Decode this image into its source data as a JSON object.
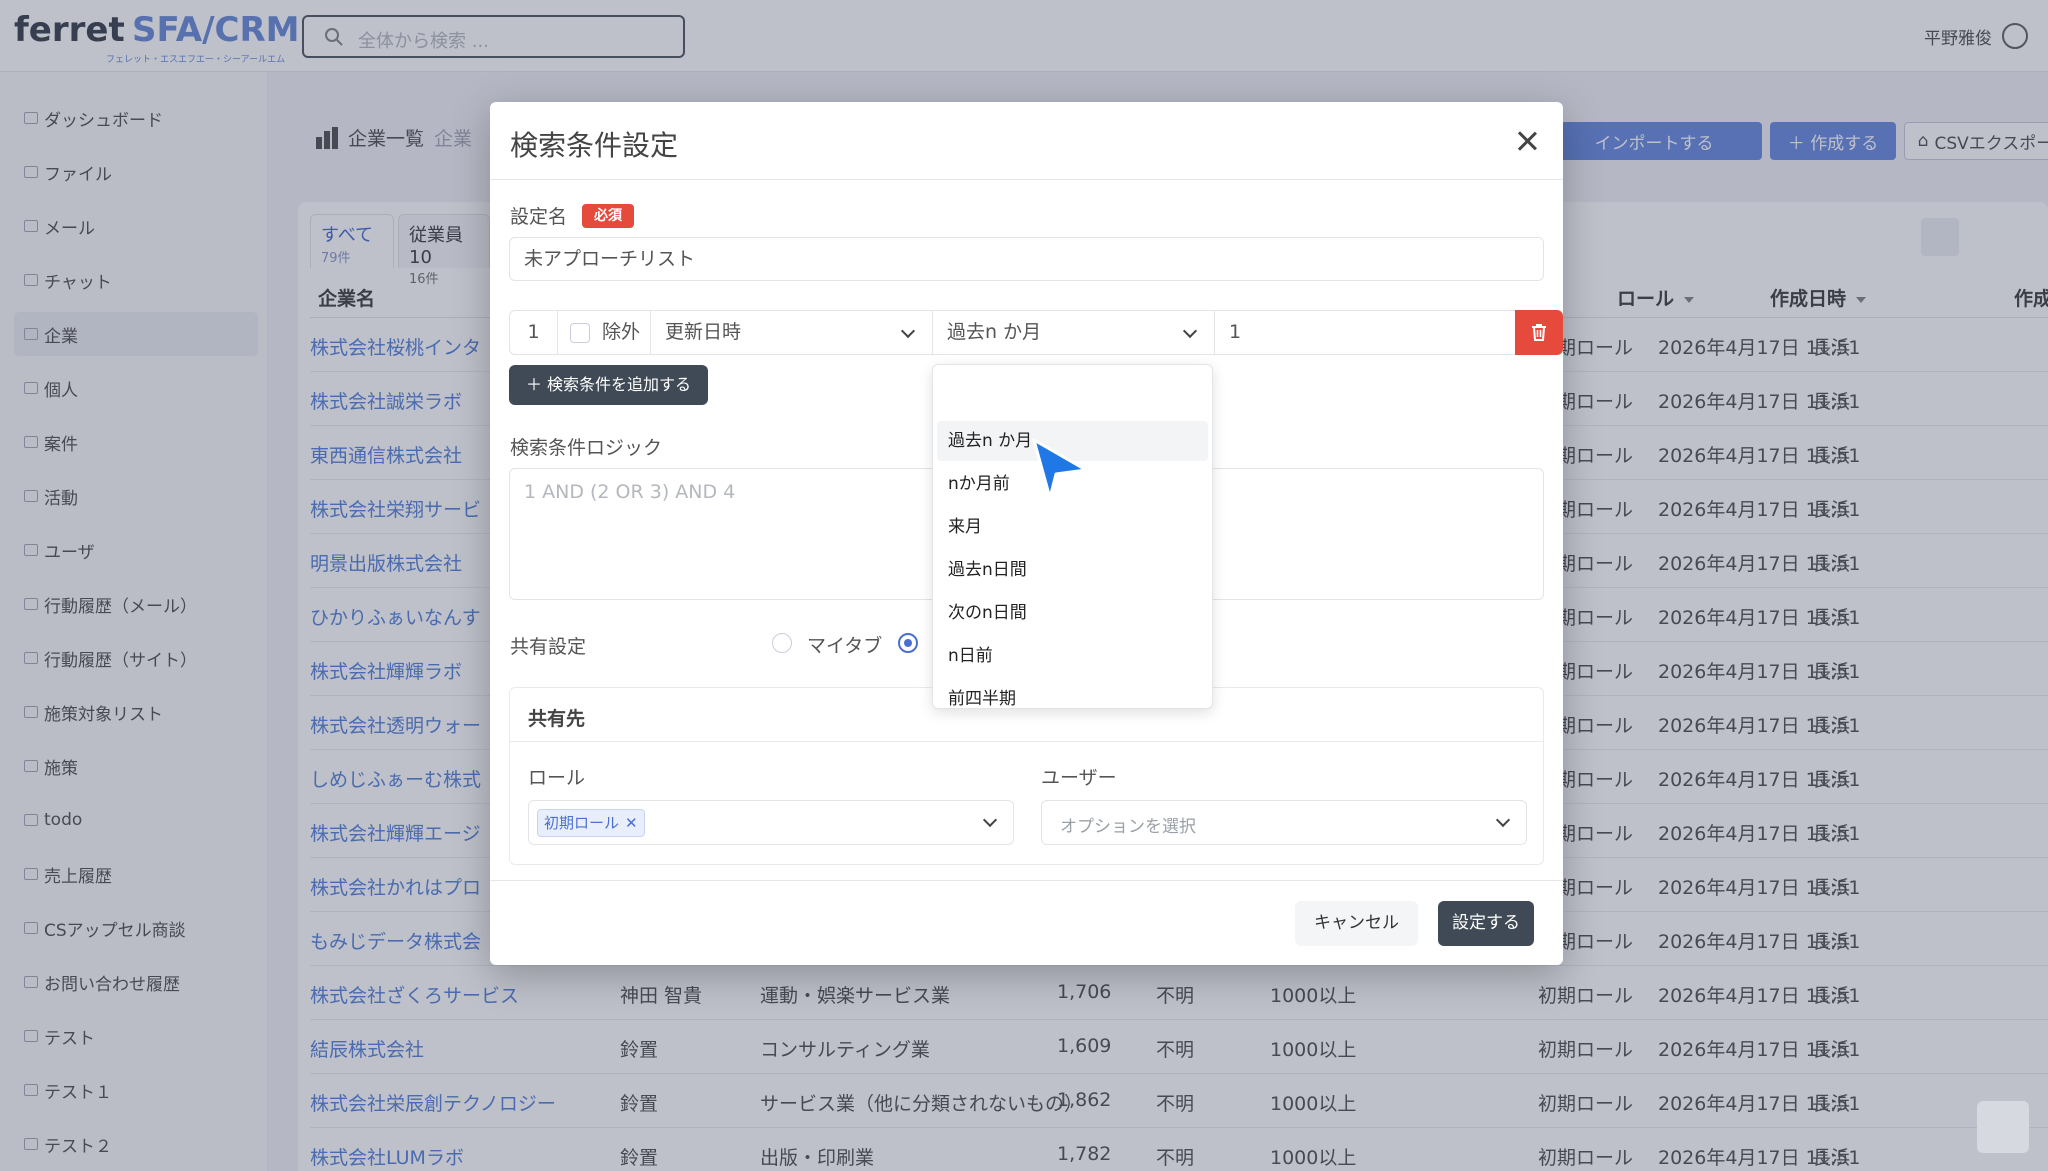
{
  "app": {
    "logo_main": "ferret",
    "logo_product": "SFA/CRM",
    "logo_sub": "フェレット・エスエフエー・シーアールエム",
    "search_placeholder": "全体から検索 ...",
    "user_name": "平野雅俊"
  },
  "sidebar": {
    "items": [
      {
        "label": "ダッシュボード"
      },
      {
        "label": "ファイル"
      },
      {
        "label": "メール"
      },
      {
        "label": "チャット"
      },
      {
        "label": "企業"
      },
      {
        "label": "個人"
      },
      {
        "label": "案件"
      },
      {
        "label": "活動"
      },
      {
        "label": "ユーザ"
      },
      {
        "label": "行動履歴（メール）"
      },
      {
        "label": "行動履歴（サイト）"
      },
      {
        "label": "施策対象リスト"
      },
      {
        "label": "施策"
      },
      {
        "label": "todo"
      },
      {
        "label": "売上履歴"
      },
      {
        "label": "CSアップセル商談"
      },
      {
        "label": "お問い合わせ履歴"
      },
      {
        "label": "テスト"
      },
      {
        "label": "テスト１"
      },
      {
        "label": "テスト２"
      }
    ],
    "active_index": 4
  },
  "page": {
    "breadcrumb": "企業一覧",
    "breadcrumb2": "企業",
    "import_label": "インポートする",
    "create_label": "＋ 作成する",
    "csv_label": "CSVエクスポート",
    "tabs": [
      {
        "label": "すべて",
        "count": "79件"
      },
      {
        "label": "従業員10",
        "count": "16件"
      }
    ]
  },
  "table": {
    "headers": {
      "name": "企業名",
      "role": "ロール",
      "created": "作成日時",
      "creator": "作成"
    },
    "rows": [
      {
        "name": "株式会社桜桃インタ",
        "owner": "",
        "industry": "",
        "employees": "",
        "capital": "",
        "size": "",
        "role": "初期ロール",
        "created": "2026年4月17日 11:51",
        "creator": "長浜"
      },
      {
        "name": "株式会社誠栄ラボ",
        "owner": "",
        "industry": "",
        "employees": "",
        "capital": "",
        "size": "",
        "role": "初期ロール",
        "created": "2026年4月17日 11:51",
        "creator": "長浜"
      },
      {
        "name": "東西通信株式会社",
        "owner": "",
        "industry": "",
        "employees": "",
        "capital": "",
        "size": "",
        "role": "初期ロール",
        "created": "2026年4月17日 11:51",
        "creator": "長浜"
      },
      {
        "name": "株式会社栄翔サービ",
        "owner": "",
        "industry": "",
        "employees": "",
        "capital": "",
        "size": "",
        "role": "初期ロール",
        "created": "2026年4月17日 11:51",
        "creator": "長浜"
      },
      {
        "name": "明景出版株式会社",
        "owner": "",
        "industry": "",
        "employees": "",
        "capital": "",
        "size": "",
        "role": "初期ロール",
        "created": "2026年4月17日 11:51",
        "creator": "長浜"
      },
      {
        "name": "ひかりふぁいなんす",
        "owner": "",
        "industry": "",
        "employees": "",
        "capital": "",
        "size": "",
        "role": "初期ロール",
        "created": "2026年4月17日 11:51",
        "creator": "長浜"
      },
      {
        "name": "株式会社輝輝ラボ",
        "owner": "",
        "industry": "",
        "employees": "",
        "capital": "",
        "size": "",
        "role": "初期ロール",
        "created": "2026年4月17日 11:51",
        "creator": "長浜"
      },
      {
        "name": "株式会社透明ウォー",
        "owner": "",
        "industry": "",
        "employees": "",
        "capital": "",
        "size": "",
        "role": "初期ロール",
        "created": "2026年4月17日 11:51",
        "creator": "長浜"
      },
      {
        "name": "しめじふぁーむ株式",
        "owner": "",
        "industry": "",
        "employees": "",
        "capital": "",
        "size": "",
        "role": "初期ロール",
        "created": "2026年4月17日 11:51",
        "creator": "長浜"
      },
      {
        "name": "株式会社輝輝エージ",
        "owner": "",
        "industry": "",
        "employees": "",
        "capital": "",
        "size": "",
        "role": "初期ロール",
        "created": "2026年4月17日 11:51",
        "creator": "長浜"
      },
      {
        "name": "株式会社かれはプロ",
        "owner": "",
        "industry": "",
        "employees": "",
        "capital": "",
        "size": "",
        "role": "初期ロール",
        "created": "2026年4月17日 11:51",
        "creator": "長浜"
      },
      {
        "name": "もみじデータ株式会",
        "owner": "",
        "industry": "",
        "employees": "",
        "capital": "",
        "size": "",
        "role": "初期ロール",
        "created": "2026年4月17日 11:51",
        "creator": "長浜"
      },
      {
        "name": "株式会社ざくろサービス",
        "owner": "神田 智貴",
        "industry": "運動・娯楽サービス業",
        "employees": "1,706",
        "capital": "不明",
        "size": "1000以上",
        "role": "初期ロール",
        "created": "2026年4月17日 11:51",
        "creator": "長浜"
      },
      {
        "name": "結辰株式会社",
        "owner": "鈴置",
        "industry": "コンサルティング業",
        "employees": "1,609",
        "capital": "不明",
        "size": "1000以上",
        "role": "初期ロール",
        "created": "2026年4月17日 11:51",
        "creator": "長浜"
      },
      {
        "name": "株式会社栄辰創テクノロジー",
        "owner": "鈴置",
        "industry": "サービス業（他に分類されないもの）",
        "employees": "1,862",
        "capital": "不明",
        "size": "1000以上",
        "role": "初期ロール",
        "created": "2026年4月17日 11:51",
        "creator": "長浜"
      },
      {
        "name": "株式会社LUMラボ",
        "owner": "鈴置",
        "industry": "出版・印刷業",
        "employees": "1,782",
        "capital": "不明",
        "size": "1000以上",
        "role": "初期ロール",
        "created": "2026年4月17日 11:51",
        "creator": "長浜"
      }
    ]
  },
  "modal": {
    "title": "検索条件設定",
    "setting_name_label": "設定名",
    "required_badge": "必須",
    "setting_name_value": "未アプローチリスト",
    "condition": {
      "number": "1",
      "exclude_label": "除外",
      "exclude_checked": false,
      "field": "更新日時",
      "operator": "過去n か月",
      "value": "1"
    },
    "add_condition_label": "＋ 検索条件を追加する",
    "logic_label": "検索条件ロジック",
    "logic_placeholder": "1 AND (2 OR 3) AND 4",
    "share_label": "共有設定",
    "share_options": [
      {
        "label": "マイタブ",
        "selected": false
      },
      {
        "label": "",
        "selected": true
      }
    ],
    "share_target_title": "共有先",
    "role_label": "ロール",
    "role_chip": "初期ロール",
    "user_label": "ユーザー",
    "user_placeholder": "オプションを選択",
    "cancel_label": "キャンセル",
    "submit_label": "設定する"
  },
  "dropdown": {
    "items": [
      {
        "label": "過去n か月",
        "hover": true
      },
      {
        "label": "nか月前"
      },
      {
        "label": "来月"
      },
      {
        "label": "過去n日間"
      },
      {
        "label": "次のn日間"
      },
      {
        "label": "n日前"
      },
      {
        "label": "前四半期"
      }
    ]
  },
  "colors": {
    "accent": "#4b6fd0",
    "danger": "#e54a3d",
    "dark_button": "#3f4a56"
  },
  "icons": [
    "search-icon",
    "user-avatar-icon",
    "close-icon",
    "trash-icon",
    "chevron-down-icon",
    "eye-off-icon",
    "arrow-cursor-icon"
  ]
}
